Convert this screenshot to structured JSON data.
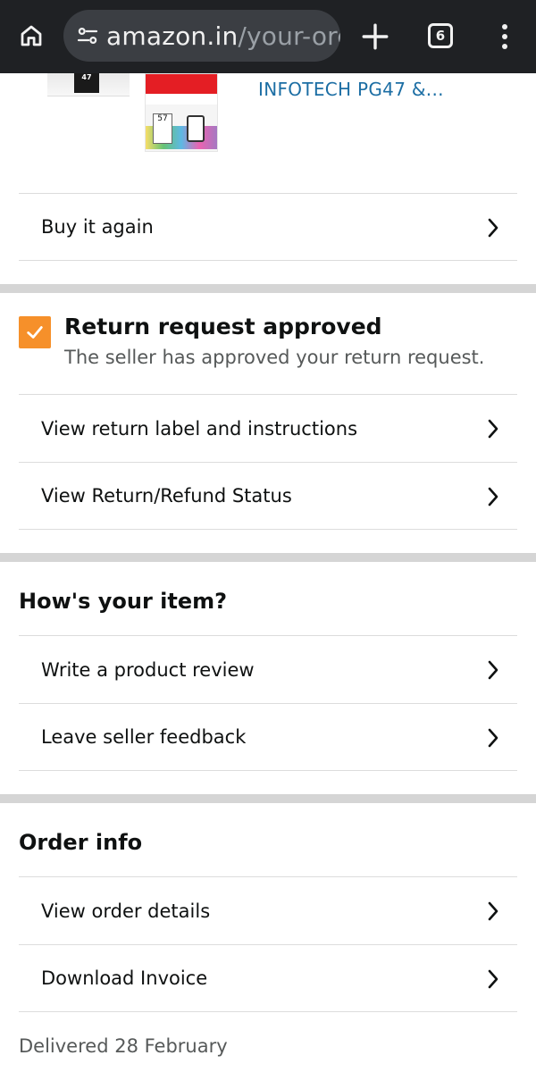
{
  "browser": {
    "url_domain": "amazon.in",
    "url_path": "/your-orc",
    "tab_count": "6"
  },
  "product": {
    "title_fragment": "INFOTECH PG47 &...",
    "black_cart_label": "47",
    "color_cart_label": "57"
  },
  "buy_again": {
    "label": "Buy it again"
  },
  "return_status": {
    "title": "Return request approved",
    "subtitle": "The seller has approved your return request.",
    "actions": [
      {
        "label": "View return label and instructions"
      },
      {
        "label": "View Return/Refund Status"
      }
    ],
    "accent_color": "#f6902a"
  },
  "review_section": {
    "heading": "How's your item?",
    "actions": [
      {
        "label": "Write a product review"
      },
      {
        "label": "Leave seller feedback"
      }
    ]
  },
  "order_info": {
    "heading": "Order info",
    "actions": [
      {
        "label": "View order details"
      },
      {
        "label": "Download Invoice"
      }
    ],
    "delivered_text": "Delivered 28 February"
  },
  "colors": {
    "browser_bar": "#1f2124",
    "link_blue": "#1c6ea4",
    "divider": "#d5d5d5"
  },
  "icons": [
    "home-icon",
    "site-settings-icon",
    "new-tab-plus-icon",
    "tab-switcher-icon",
    "more-vert-icon",
    "chevron-right-icon",
    "checkmark-icon"
  ]
}
